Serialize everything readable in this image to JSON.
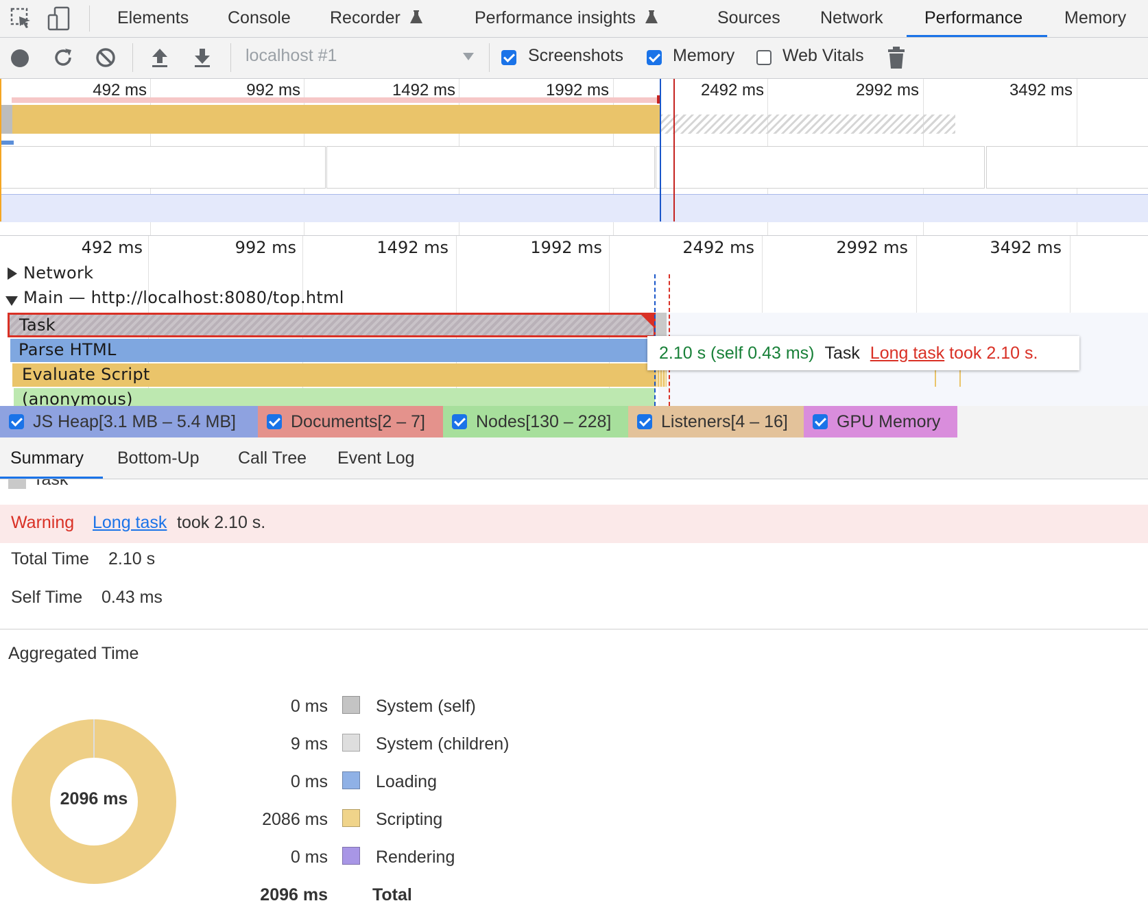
{
  "tabs": {
    "elements": "Elements",
    "console": "Console",
    "recorder": "Recorder",
    "performance_insights": "Performance insights",
    "sources": "Sources",
    "network": "Network",
    "performance": "Performance",
    "memory": "Memory"
  },
  "toolbar": {
    "profile_select": "localhost #1",
    "screenshots": "Screenshots",
    "memory": "Memory",
    "web_vitals": "Web Vitals",
    "screenshots_checked": true,
    "memory_checked": true,
    "web_vitals_checked": false
  },
  "overview": {
    "ticks": [
      "492 ms",
      "992 ms",
      "1492 ms",
      "1992 ms",
      "2492 ms",
      "2992 ms",
      "3492 ms"
    ]
  },
  "flame": {
    "ticks": [
      "492 ms",
      "992 ms",
      "1492 ms",
      "1992 ms",
      "2492 ms",
      "2992 ms",
      "3492 ms"
    ],
    "network_label": "Network",
    "main_label": "Main — http://localhost:8080/top.html",
    "task": "Task",
    "parse_html": "Parse HTML",
    "evaluate_script": "Evaluate Script",
    "anonymous": "(anonymous)"
  },
  "tooltip": {
    "time": "2.10 s (self 0.43 ms)",
    "name": "Task",
    "link": "Long task",
    "rest": "took 2.10 s."
  },
  "counters": {
    "js_heap": "JS Heap[3.1 MB – 5.4 MB]",
    "documents": "Documents[2 – 7]",
    "nodes": "Nodes[130 – 228]",
    "listeners": "Listeners[4 – 16]",
    "gpu_memory": "GPU Memory"
  },
  "detail_tabs": {
    "summary": "Summary",
    "bottom_up": "Bottom-Up",
    "call_tree": "Call Tree",
    "event_log": "Event Log"
  },
  "summary": {
    "title": "Task",
    "warning_label": "Warning",
    "warning_link": "Long task",
    "warning_rest": "took 2.10 s.",
    "total_time_label": "Total Time",
    "total_time": "2.10 s",
    "self_time_label": "Self Time",
    "self_time": "0.43 ms",
    "aggregated_title": "Aggregated Time",
    "donut_center": "2096 ms",
    "legend": [
      {
        "value": "0 ms",
        "label": "System (self)",
        "color": "#c4c4c4"
      },
      {
        "value": "9 ms",
        "label": "System (children)",
        "color": "#dedede"
      },
      {
        "value": "0 ms",
        "label": "Loading",
        "color": "#8fb1e6"
      },
      {
        "value": "2086 ms",
        "label": "Scripting",
        "color": "#f0d48a"
      },
      {
        "value": "0 ms",
        "label": "Rendering",
        "color": "#a896e6"
      }
    ],
    "total_value": "2096 ms",
    "total_label": "Total"
  },
  "colors": {
    "accent": "#1a73e8",
    "scripting": "#eac46a",
    "loading": "#7fa7e0",
    "warning_red": "#d93025",
    "long_task_green": "#188038"
  }
}
